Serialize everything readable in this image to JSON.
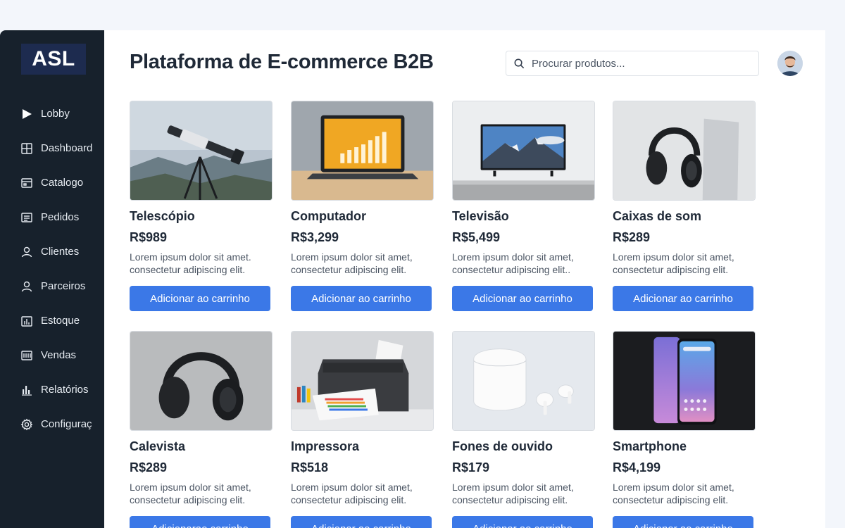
{
  "brand": {
    "logo_text": "ASL"
  },
  "sidebar": {
    "items": [
      {
        "label": "Lobby",
        "icon": "play-icon"
      },
      {
        "label": "Dashboard",
        "icon": "grid-icon"
      },
      {
        "label": "Catalogo",
        "icon": "catalog-icon"
      },
      {
        "label": "Pedidos",
        "icon": "orders-icon"
      },
      {
        "label": "Clientes",
        "icon": "user-icon"
      },
      {
        "label": "Parceiros",
        "icon": "user-icon"
      },
      {
        "label": "Estoque",
        "icon": "inventory-icon"
      },
      {
        "label": "Vendas",
        "icon": "sales-icon"
      },
      {
        "label": "Relatórios",
        "icon": "bar-chart-icon"
      },
      {
        "label": "Configuraç",
        "icon": "gear-icon"
      }
    ]
  },
  "header": {
    "title": "Plataforma de E-commerce B2B",
    "search_placeholder": "Procurar produtos..."
  },
  "products": [
    {
      "name": "Telescópio",
      "price": "R$989",
      "desc": "Lorem ipsum dolor sit amet. consectetur adipiscing elit.",
      "button": "Adicionar ao carrinho"
    },
    {
      "name": "Computador",
      "price": "R$3,299",
      "desc": "Lorem ipsum dolor sit amet, consectetur adipiscing elit.",
      "button": "Adicionar ao carrinho"
    },
    {
      "name": "Televisão",
      "price": "R$5,499",
      "desc": "Lorem ipsum dolor sit amet, consectetur adipiscing elit..",
      "button": "Adicionar ao carrinho"
    },
    {
      "name": "Caixas de som",
      "price": "R$289",
      "desc": "Lorem ipsum dolor sit amet, consectetur adipiscing elit.",
      "button": "Adicionar ao carrinho"
    },
    {
      "name": "Calevista",
      "price": "R$289",
      "desc": "Lorem ipsum dolor sit amet, consectetur adipiscing elit.",
      "button": "Adicionarao carrinho"
    },
    {
      "name": "Impressora",
      "price": "R$518",
      "desc": "Lorem ipsum dolor sit amet, consectetur adipiscing elit.",
      "button": "Adicionar ao carrinho"
    },
    {
      "name": "Fones de ouvido",
      "price": "R$179",
      "desc": "Lorem ipsum dolor sit amet, consectetur adipiscing elit.",
      "button": "Adicionar ao carrinho"
    },
    {
      "name": "Smartphone",
      "price": "R$4,199",
      "desc": "Lorem ipsum dolor sit amet, consectetur adipiscing elit.",
      "button": "Adicionar ao carrinho"
    }
  ],
  "colors": {
    "sidebar_bg": "#17212c",
    "accent": "#3b78e7",
    "logo_bg": "#1d2b4f"
  }
}
